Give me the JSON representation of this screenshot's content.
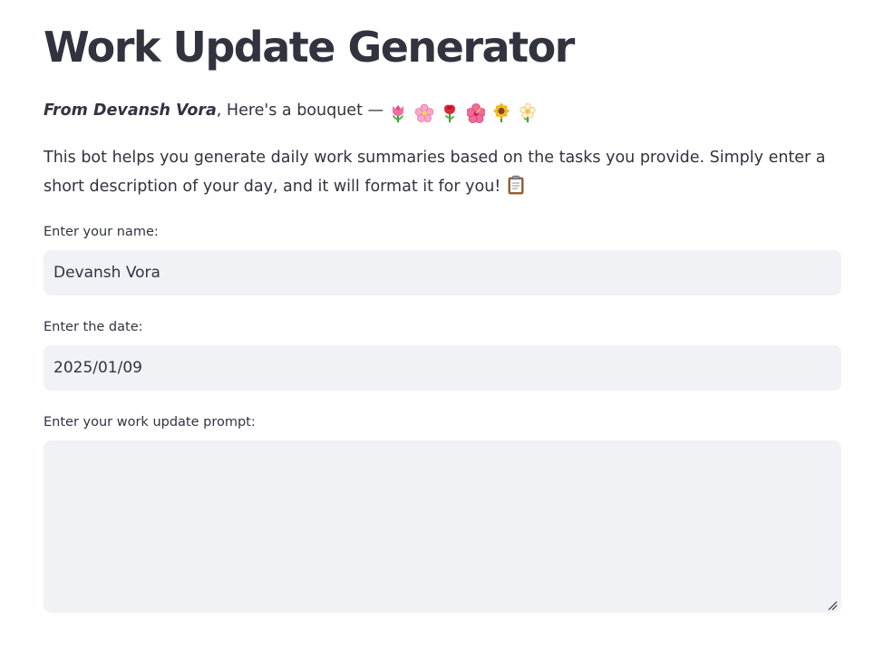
{
  "title": "Work Update Generator",
  "bouquet": {
    "from_text": "From Devansh Vora",
    "rest_text": ", Here's a bouquet —",
    "flowers": [
      "tulip-icon",
      "cherry-blossom-icon",
      "rose-icon",
      "hibiscus-icon",
      "sunflower-icon",
      "blossom-icon"
    ]
  },
  "description": {
    "text": "This bot helps you generate daily work summaries based on the tasks you provide. Simply enter a short description of your day, and it will format it for you!",
    "icon": "clipboard-icon"
  },
  "name_field": {
    "label": "Enter your name:",
    "value": "Devansh Vora"
  },
  "date_field": {
    "label": "Enter the date:",
    "value": "2025/01/09"
  },
  "prompt_field": {
    "label": "Enter your work update prompt:",
    "value": ""
  },
  "colors": {
    "text": "#31333f",
    "input_bg": "#f0f2f6",
    "background": "#ffffff"
  }
}
